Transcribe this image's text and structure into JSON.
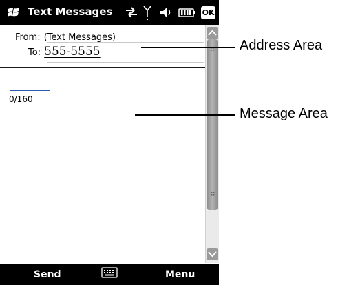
{
  "window": {
    "title": "Text Messages",
    "ok_label": "OK"
  },
  "address": {
    "from_label": "From:",
    "from_value": "(Text Messages)",
    "to_label": "To:",
    "to_value": "555-5555"
  },
  "message": {
    "char_count": "0/160"
  },
  "softkeys": {
    "left": "Send",
    "right": "Menu"
  },
  "callouts": {
    "address_area": "Address Area",
    "message_area": "Message Area"
  },
  "icons": [
    "windows-logo-icon",
    "connectivity-icon",
    "signal-icon",
    "volume-icon",
    "battery-icon",
    "keyboard-icon"
  ]
}
